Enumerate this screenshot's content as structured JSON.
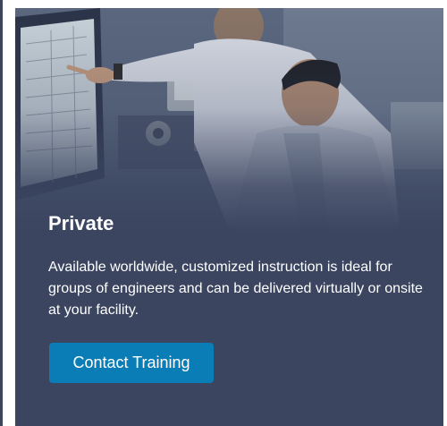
{
  "card": {
    "title": "Private",
    "description": "Available worldwide, customized instruction is ideal for groups of engineers and can be delivered virtually or onsite at your facility.",
    "cta_label": "Contact Training"
  },
  "colors": {
    "card_background": "#3b4560",
    "button_background": "#0a7db7",
    "text": "#ffffff"
  }
}
